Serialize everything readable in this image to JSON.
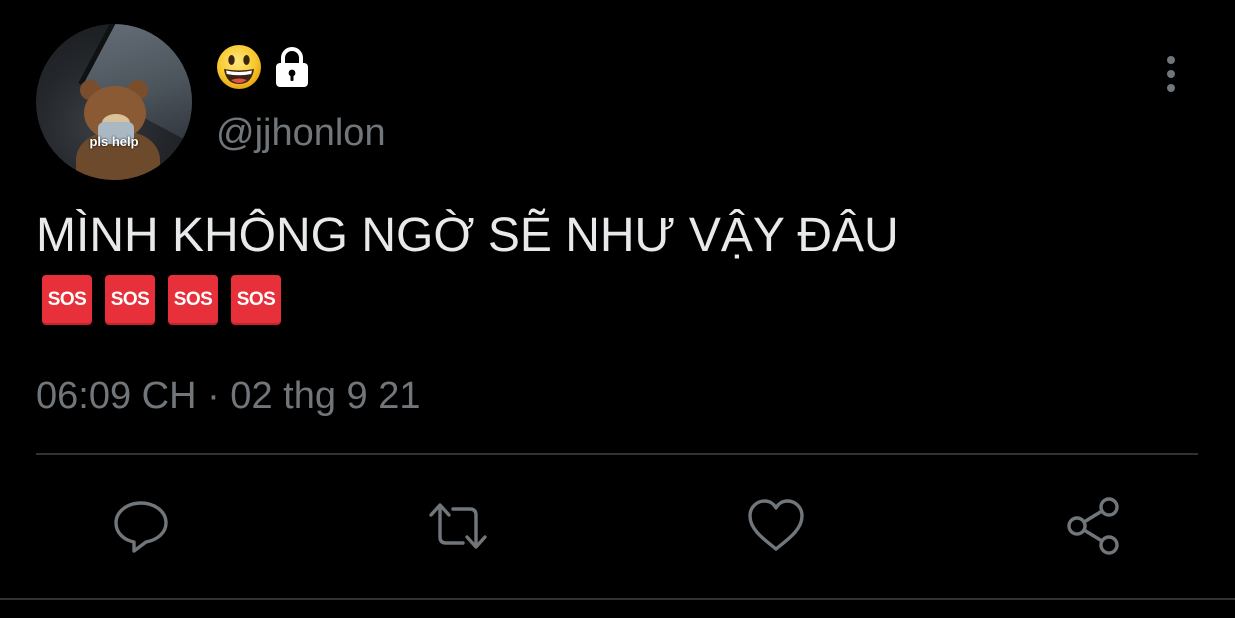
{
  "author": {
    "display_name_emojis": [
      "grinning-face-emoji",
      "lock-icon"
    ],
    "handle": "@jjhonlon",
    "avatar_caption": "pls help"
  },
  "tweet": {
    "text": "MÌNH KHÔNG NGỜ SẼ NHƯ VẬY ĐÂU",
    "emojis": [
      {
        "label": "SOS",
        "icon": "sos-emoji"
      },
      {
        "label": "SOS",
        "icon": "sos-emoji"
      },
      {
        "label": "SOS",
        "icon": "sos-emoji"
      },
      {
        "label": "SOS",
        "icon": "sos-emoji"
      }
    ],
    "timestamp": "06:09 CH · 02 thg 9 21"
  },
  "actions": [
    {
      "name": "reply",
      "icon": "reply-icon"
    },
    {
      "name": "retweet",
      "icon": "retweet-icon"
    },
    {
      "name": "like",
      "icon": "like-icon"
    },
    {
      "name": "share",
      "icon": "share-icon"
    }
  ],
  "colors": {
    "background": "#000000",
    "primary_text": "#e7e9ea",
    "secondary_text": "#71767b",
    "divider": "#2f3336",
    "sos_red": "#e8303a"
  }
}
